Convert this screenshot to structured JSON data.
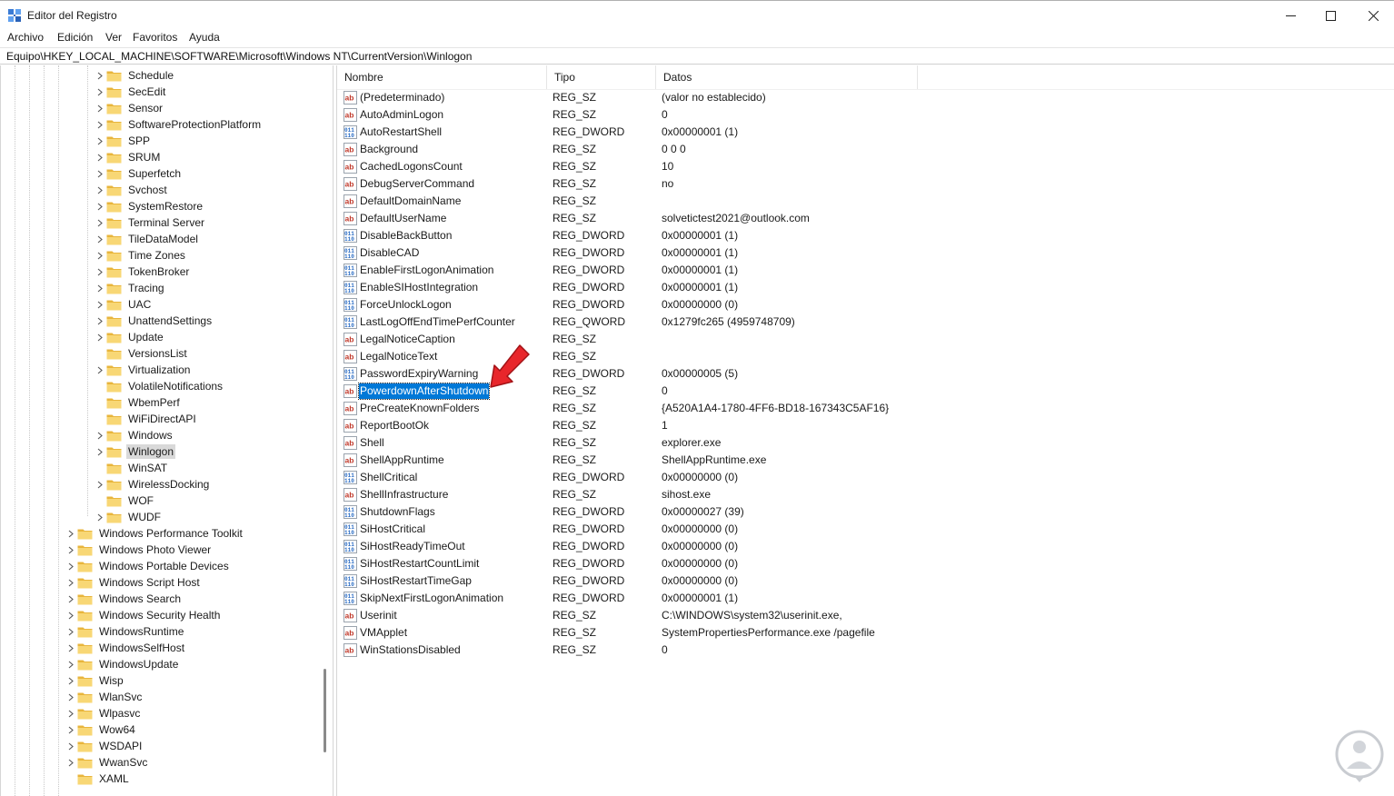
{
  "window": {
    "title": "Editor del Registro"
  },
  "menu": [
    "Archivo",
    "Edición",
    "Ver",
    "Favoritos",
    "Ayuda"
  ],
  "address": "Equipo\\HKEY_LOCAL_MACHINE\\SOFTWARE\\Microsoft\\Windows NT\\CurrentVersion\\Winlogon",
  "tree": {
    "children": [
      {
        "label": "Schedule",
        "expandable": true
      },
      {
        "label": "SecEdit",
        "expandable": true
      },
      {
        "label": "Sensor",
        "expandable": true
      },
      {
        "label": "SoftwareProtectionPlatform",
        "expandable": true
      },
      {
        "label": "SPP",
        "expandable": true
      },
      {
        "label": "SRUM",
        "expandable": true
      },
      {
        "label": "Superfetch",
        "expandable": true
      },
      {
        "label": "Svchost",
        "expandable": true
      },
      {
        "label": "SystemRestore",
        "expandable": true
      },
      {
        "label": "Terminal Server",
        "expandable": true
      },
      {
        "label": "TileDataModel",
        "expandable": true
      },
      {
        "label": "Time Zones",
        "expandable": true
      },
      {
        "label": "TokenBroker",
        "expandable": true
      },
      {
        "label": "Tracing",
        "expandable": true
      },
      {
        "label": "UAC",
        "expandable": true
      },
      {
        "label": "UnattendSettings",
        "expandable": true
      },
      {
        "label": "Update",
        "expandable": true
      },
      {
        "label": "VersionsList",
        "expandable": false
      },
      {
        "label": "Virtualization",
        "expandable": true
      },
      {
        "label": "VolatileNotifications",
        "expandable": false
      },
      {
        "label": "WbemPerf",
        "expandable": false
      },
      {
        "label": "WiFiDirectAPI",
        "expandable": false
      },
      {
        "label": "Windows",
        "expandable": true
      },
      {
        "label": "Winlogon",
        "expandable": true,
        "selected": true
      },
      {
        "label": "WinSAT",
        "expandable": false
      },
      {
        "label": "WirelessDocking",
        "expandable": true
      },
      {
        "label": "WOF",
        "expandable": false
      },
      {
        "label": "WUDF",
        "expandable": true
      }
    ],
    "siblings": [
      {
        "label": "Windows Performance Toolkit",
        "expandable": true
      },
      {
        "label": "Windows Photo Viewer",
        "expandable": true
      },
      {
        "label": "Windows Portable Devices",
        "expandable": true
      },
      {
        "label": "Windows Script Host",
        "expandable": true
      },
      {
        "label": "Windows Search",
        "expandable": true
      },
      {
        "label": "Windows Security Health",
        "expandable": true
      },
      {
        "label": "WindowsRuntime",
        "expandable": true
      },
      {
        "label": "WindowsSelfHost",
        "expandable": true
      },
      {
        "label": "WindowsUpdate",
        "expandable": true
      },
      {
        "label": "Wisp",
        "expandable": true
      },
      {
        "label": "WlanSvc",
        "expandable": true
      },
      {
        "label": "Wlpasvc",
        "expandable": true
      },
      {
        "label": "Wow64",
        "expandable": true
      },
      {
        "label": "WSDAPI",
        "expandable": true
      },
      {
        "label": "WwanSvc",
        "expandable": true
      },
      {
        "label": "XAML",
        "expandable": false
      }
    ]
  },
  "list": {
    "columns": [
      "Nombre",
      "Tipo",
      "Datos"
    ],
    "rows": [
      {
        "name": "(Predeterminado)",
        "type": "REG_SZ",
        "data": "(valor no establecido)",
        "icon": "string-value-icon"
      },
      {
        "name": "AutoAdminLogon",
        "type": "REG_SZ",
        "data": "0",
        "icon": "string-value-icon"
      },
      {
        "name": "AutoRestartShell",
        "type": "REG_DWORD",
        "data": "0x00000001 (1)",
        "icon": "binary-value-icon"
      },
      {
        "name": "Background",
        "type": "REG_SZ",
        "data": "0 0 0",
        "icon": "string-value-icon"
      },
      {
        "name": "CachedLogonsCount",
        "type": "REG_SZ",
        "data": "10",
        "icon": "string-value-icon"
      },
      {
        "name": "DebugServerCommand",
        "type": "REG_SZ",
        "data": "no",
        "icon": "string-value-icon"
      },
      {
        "name": "DefaultDomainName",
        "type": "REG_SZ",
        "data": "",
        "icon": "string-value-icon"
      },
      {
        "name": "DefaultUserName",
        "type": "REG_SZ",
        "data": "solvetictest2021@outlook.com",
        "icon": "string-value-icon"
      },
      {
        "name": "DisableBackButton",
        "type": "REG_DWORD",
        "data": "0x00000001 (1)",
        "icon": "binary-value-icon"
      },
      {
        "name": "DisableCAD",
        "type": "REG_DWORD",
        "data": "0x00000001 (1)",
        "icon": "binary-value-icon"
      },
      {
        "name": "EnableFirstLogonAnimation",
        "type": "REG_DWORD",
        "data": "0x00000001 (1)",
        "icon": "binary-value-icon"
      },
      {
        "name": "EnableSIHostIntegration",
        "type": "REG_DWORD",
        "data": "0x00000001 (1)",
        "icon": "binary-value-icon"
      },
      {
        "name": "ForceUnlockLogon",
        "type": "REG_DWORD",
        "data": "0x00000000 (0)",
        "icon": "binary-value-icon"
      },
      {
        "name": "LastLogOffEndTimePerfCounter",
        "type": "REG_QWORD",
        "data": "0x1279fc265 (4959748709)",
        "icon": "binary-value-icon"
      },
      {
        "name": "LegalNoticeCaption",
        "type": "REG_SZ",
        "data": "",
        "icon": "string-value-icon"
      },
      {
        "name": "LegalNoticeText",
        "type": "REG_SZ",
        "data": "",
        "icon": "string-value-icon"
      },
      {
        "name": "PasswordExpiryWarning",
        "type": "REG_DWORD",
        "data": "0x00000005 (5)",
        "icon": "binary-value-icon"
      },
      {
        "name": "PowerdownAfterShutdown",
        "type": "REG_SZ",
        "data": "0",
        "icon": "string-value-icon",
        "selected": true
      },
      {
        "name": "PreCreateKnownFolders",
        "type": "REG_SZ",
        "data": "{A520A1A4-1780-4FF6-BD18-167343C5AF16}",
        "icon": "string-value-icon"
      },
      {
        "name": "ReportBootOk",
        "type": "REG_SZ",
        "data": "1",
        "icon": "string-value-icon"
      },
      {
        "name": "Shell",
        "type": "REG_SZ",
        "data": "explorer.exe",
        "icon": "string-value-icon"
      },
      {
        "name": "ShellAppRuntime",
        "type": "REG_SZ",
        "data": "ShellAppRuntime.exe",
        "icon": "string-value-icon"
      },
      {
        "name": "ShellCritical",
        "type": "REG_DWORD",
        "data": "0x00000000 (0)",
        "icon": "binary-value-icon"
      },
      {
        "name": "ShellInfrastructure",
        "type": "REG_SZ",
        "data": "sihost.exe",
        "icon": "string-value-icon"
      },
      {
        "name": "ShutdownFlags",
        "type": "REG_DWORD",
        "data": "0x00000027 (39)",
        "icon": "binary-value-icon"
      },
      {
        "name": "SiHostCritical",
        "type": "REG_DWORD",
        "data": "0x00000000 (0)",
        "icon": "binary-value-icon"
      },
      {
        "name": "SiHostReadyTimeOut",
        "type": "REG_DWORD",
        "data": "0x00000000 (0)",
        "icon": "binary-value-icon"
      },
      {
        "name": "SiHostRestartCountLimit",
        "type": "REG_DWORD",
        "data": "0x00000000 (0)",
        "icon": "binary-value-icon"
      },
      {
        "name": "SiHostRestartTimeGap",
        "type": "REG_DWORD",
        "data": "0x00000000 (0)",
        "icon": "binary-value-icon"
      },
      {
        "name": "SkipNextFirstLogonAnimation",
        "type": "REG_DWORD",
        "data": "0x00000001 (1)",
        "icon": "binary-value-icon"
      },
      {
        "name": "Userinit",
        "type": "REG_SZ",
        "data": "C:\\WINDOWS\\system32\\userinit.exe,",
        "icon": "string-value-icon"
      },
      {
        "name": "VMApplet",
        "type": "REG_SZ",
        "data": "SystemPropertiesPerformance.exe /pagefile",
        "icon": "string-value-icon"
      },
      {
        "name": "WinStationsDisabled",
        "type": "REG_SZ",
        "data": "0",
        "icon": "string-value-icon"
      }
    ]
  },
  "colors": {
    "selection": "#0078d7",
    "folder": "#f8d775",
    "folder_dark": "#e8b53c",
    "arrow": "#e8262b",
    "string_icon_text": "#c0392b",
    "binary_icon": "#2a6cc4"
  }
}
